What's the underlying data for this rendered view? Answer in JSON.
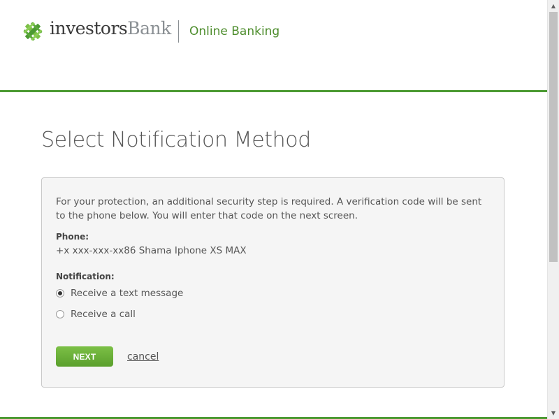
{
  "header": {
    "logo_part1": "investors",
    "logo_part2": "Bank",
    "title": "Online Banking",
    "brand_color": "#4c9a32"
  },
  "main": {
    "title": "Select Notification Method",
    "intro": "For your protection, an additional security step is required. A verification code will be sent to the phone below. You will enter that code on the next screen.",
    "phone_label": "Phone:",
    "phone_value": "+x xxx-xxx-xx86 Shama Iphone XS MAX",
    "notification_label": "Notification:",
    "options": [
      {
        "label": "Receive a text message",
        "selected": true
      },
      {
        "label": "Receive a call",
        "selected": false
      }
    ],
    "next_label": "NEXT",
    "cancel_label": "cancel"
  },
  "icons": {
    "logo": "investors-bank-logo-icon",
    "scroll_up": "scroll-up-arrow-icon",
    "scroll_down": "scroll-down-arrow-icon"
  }
}
